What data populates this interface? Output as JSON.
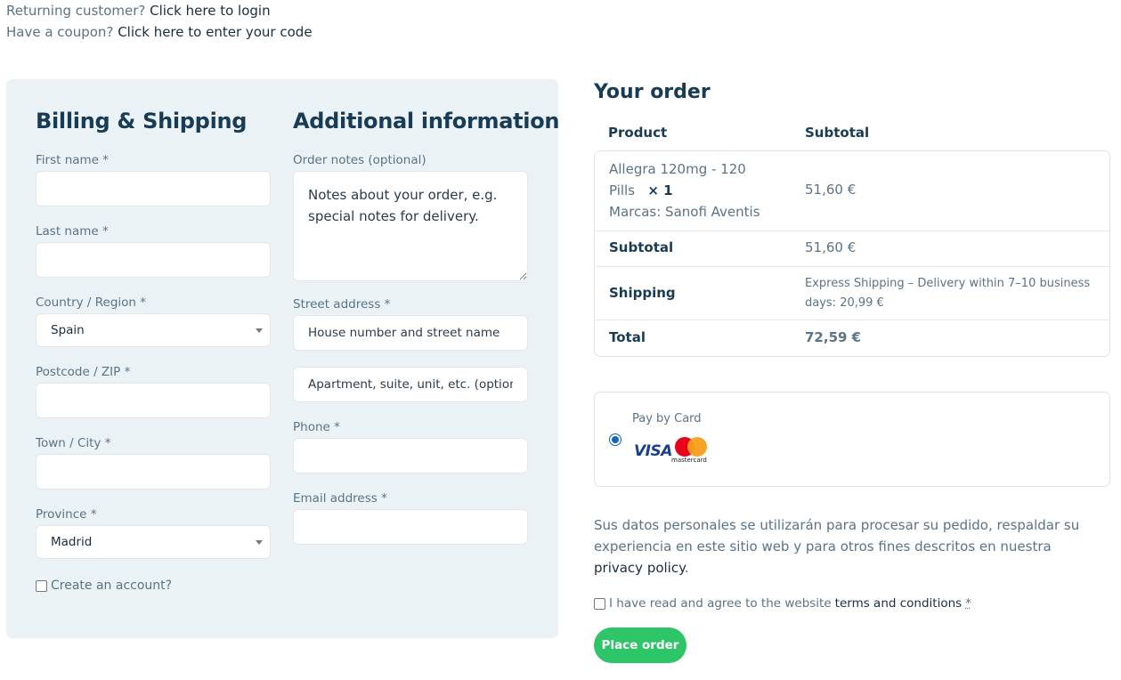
{
  "notices": {
    "login_prefix": "Returning customer?",
    "login_link": "Click here to login",
    "coupon_prefix": "Have a coupon?",
    "coupon_link": "Click here to enter your code"
  },
  "billing": {
    "title": "Billing & Shipping",
    "first_name_label": "First name *",
    "last_name_label": "Last name *",
    "country_label": "Country / Region *",
    "country_value": "Spain",
    "postcode_label": "Postcode / ZIP *",
    "city_label": "Town / City *",
    "province_label": "Province *",
    "province_value": "Madrid",
    "create_account_label": "Create an account?"
  },
  "additional": {
    "title": "Additional information",
    "notes_label": "Order notes (optional)",
    "notes_placeholder": "Notes about your order, e.g. special notes for delivery.",
    "street_label": "Street address *",
    "street_placeholder": "House number and street name",
    "apartment_placeholder": "Apartment, suite, unit, etc. (optional)",
    "phone_label": "Phone *",
    "email_label": "Email address *"
  },
  "order": {
    "title": "Your order",
    "col_product": "Product",
    "col_subtotal": "Subtotal",
    "item_name_line1": "Allegra 120mg - 120",
    "item_name_line2": "Pills",
    "item_qty": "× 1",
    "item_brand": "Marcas: Sanofi Aventis",
    "item_price": "51,60 €",
    "subtotal_label": "Subtotal",
    "subtotal_value": "51,60 €",
    "shipping_label": "Shipping",
    "shipping_line1": "Express Shipping – Delivery within 7–10 business",
    "shipping_line2": "days: 20,99 €",
    "total_label": "Total",
    "total_value": "72,59 €"
  },
  "payment": {
    "method_label": "Pay by Card",
    "visa_text": "VISA",
    "mastercard_text": "mastercard"
  },
  "privacy": {
    "text": "Sus datos personales se utilizarán para procesar su pedido, respaldar su experiencia en este sitio web y para otros fines descritos en nuestra",
    "link": "privacy policy",
    "end": "."
  },
  "terms": {
    "prefix": "I have read and agree to the website",
    "link": "terms and conditions",
    "required": "*"
  },
  "place_order_label": "Place order",
  "colors": {
    "panel_bg": "#eaf2f5",
    "heading": "#183b56",
    "muted_text": "#5b7386",
    "button_green": "#2ec468",
    "radio_blue": "#1565c0"
  }
}
